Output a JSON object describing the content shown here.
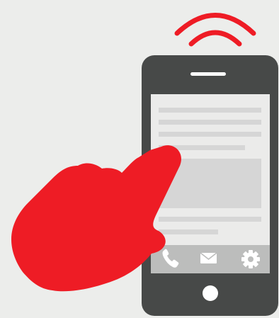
{
  "illustration": {
    "subject": "hand-tapping-smartphone",
    "colors": {
      "background": "#ecedeb",
      "accent_red": "#ee1c25",
      "phone_body": "#474948",
      "screen": "#ebebea",
      "content_bar": "#d6d6d6",
      "dock": "#bcbdbc",
      "icon_white": "#ffffff"
    },
    "signal_waves": 2,
    "dock_icons": [
      "phone-icon",
      "mail-icon",
      "gear-icon"
    ],
    "screen_text_lines": 7,
    "screen_content_blocks": 1
  }
}
